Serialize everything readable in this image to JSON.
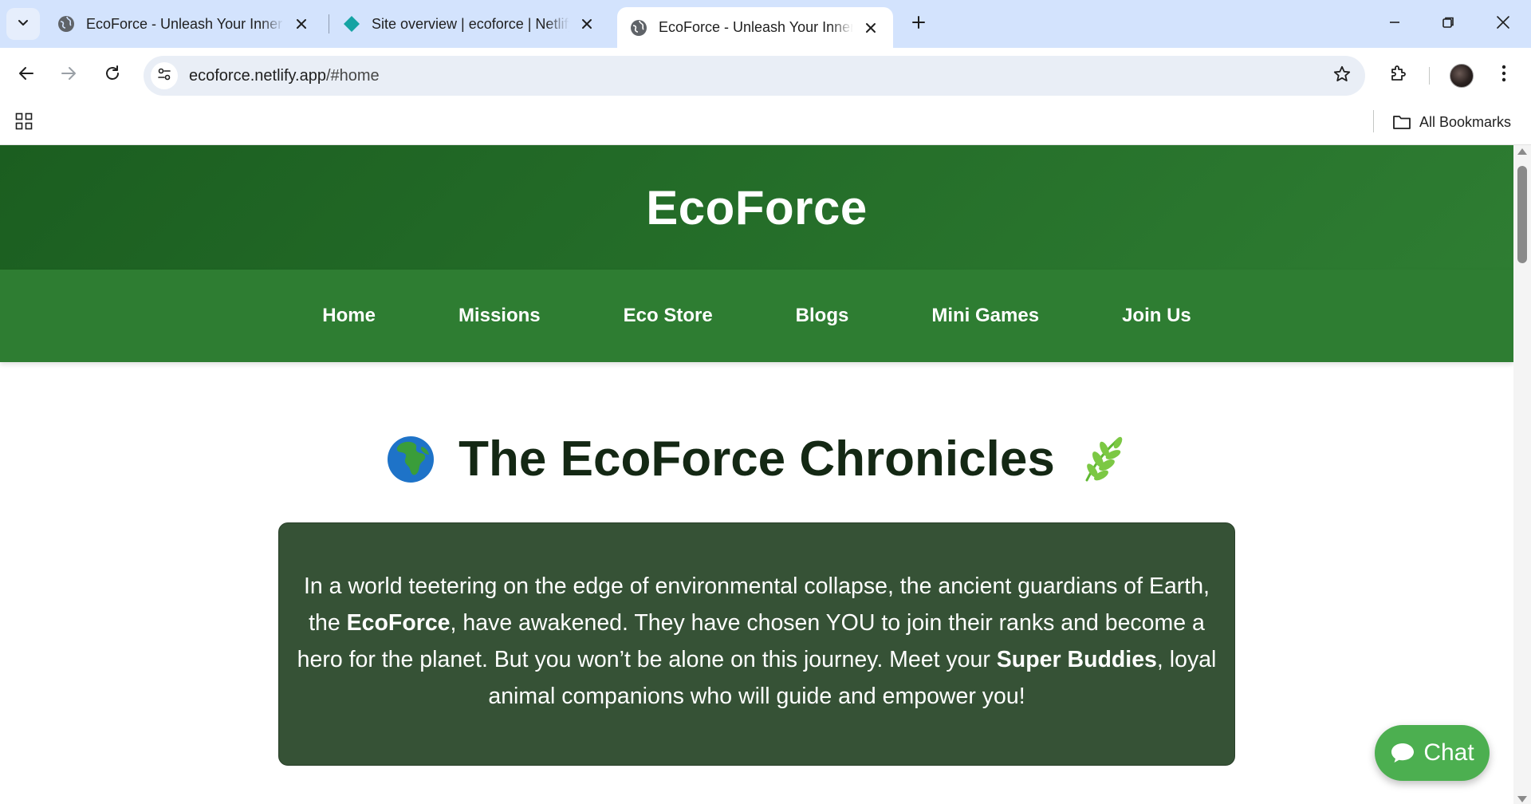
{
  "browser": {
    "tabs": [
      {
        "title": "EcoForce - Unleash Your Inner Hero",
        "icon": "globe-icon",
        "active": false
      },
      {
        "title": "Site overview | ecoforce | Netlify",
        "icon": "netlify-icon",
        "active": false
      },
      {
        "title": "EcoForce - Unleash Your Inner Hero",
        "icon": "globe-icon",
        "active": true
      }
    ],
    "url": {
      "host": "ecoforce.netlify.app",
      "path": "/#home"
    },
    "bookmarks_label": "All Bookmarks"
  },
  "site": {
    "brand": "EcoForce",
    "nav": [
      "Home",
      "Missions",
      "Eco Store",
      "Blogs",
      "Mini Games",
      "Join Us"
    ],
    "heading": "The EcoForce Chronicles",
    "heading_emoji_left": "globe-africa-icon",
    "heading_emoji_right": "herb-icon",
    "story": {
      "p1": "In a world teetering on the edge of environmental collapse, the ancient guardians of Earth, the ",
      "b1": "EcoForce",
      "p2": ", have awakened. They have chosen YOU to join their ranks and become a hero for the planet. But you won’t be alone on this journey. Meet your ",
      "b2": "Super Buddies",
      "p3": ", loyal animal companions who will guide and empower you!"
    },
    "chat_label": "Chat"
  },
  "colors": {
    "header_dark": "#1b5e20",
    "nav_green": "#2e7d32",
    "story_bg": "#365236",
    "chat_green": "#4caf50",
    "tabstrip": "#d3e3fd"
  }
}
